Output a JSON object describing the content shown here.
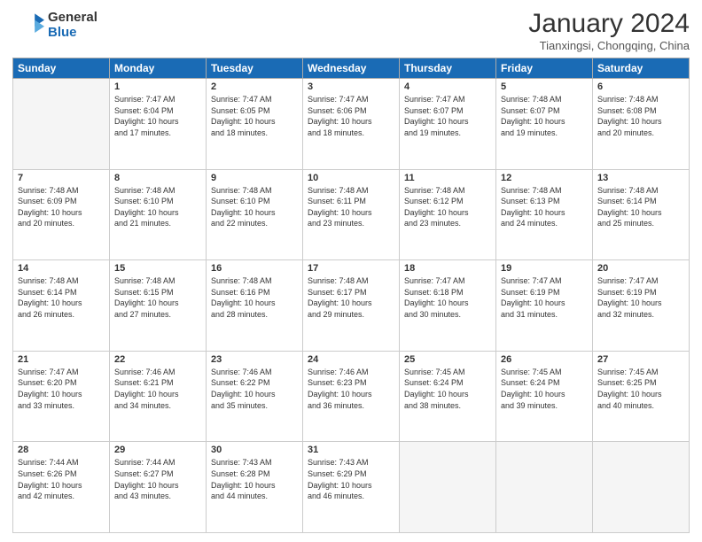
{
  "logo": {
    "line1": "General",
    "line2": "Blue"
  },
  "title": "January 2024",
  "subtitle": "Tianxingsi, Chongqing, China",
  "headers": [
    "Sunday",
    "Monday",
    "Tuesday",
    "Wednesday",
    "Thursday",
    "Friday",
    "Saturday"
  ],
  "weeks": [
    [
      {
        "num": "",
        "info": ""
      },
      {
        "num": "1",
        "info": "Sunrise: 7:47 AM\nSunset: 6:04 PM\nDaylight: 10 hours\nand 17 minutes."
      },
      {
        "num": "2",
        "info": "Sunrise: 7:47 AM\nSunset: 6:05 PM\nDaylight: 10 hours\nand 18 minutes."
      },
      {
        "num": "3",
        "info": "Sunrise: 7:47 AM\nSunset: 6:06 PM\nDaylight: 10 hours\nand 18 minutes."
      },
      {
        "num": "4",
        "info": "Sunrise: 7:47 AM\nSunset: 6:07 PM\nDaylight: 10 hours\nand 19 minutes."
      },
      {
        "num": "5",
        "info": "Sunrise: 7:48 AM\nSunset: 6:07 PM\nDaylight: 10 hours\nand 19 minutes."
      },
      {
        "num": "6",
        "info": "Sunrise: 7:48 AM\nSunset: 6:08 PM\nDaylight: 10 hours\nand 20 minutes."
      }
    ],
    [
      {
        "num": "7",
        "info": "Sunrise: 7:48 AM\nSunset: 6:09 PM\nDaylight: 10 hours\nand 20 minutes."
      },
      {
        "num": "8",
        "info": "Sunrise: 7:48 AM\nSunset: 6:10 PM\nDaylight: 10 hours\nand 21 minutes."
      },
      {
        "num": "9",
        "info": "Sunrise: 7:48 AM\nSunset: 6:10 PM\nDaylight: 10 hours\nand 22 minutes."
      },
      {
        "num": "10",
        "info": "Sunrise: 7:48 AM\nSunset: 6:11 PM\nDaylight: 10 hours\nand 23 minutes."
      },
      {
        "num": "11",
        "info": "Sunrise: 7:48 AM\nSunset: 6:12 PM\nDaylight: 10 hours\nand 23 minutes."
      },
      {
        "num": "12",
        "info": "Sunrise: 7:48 AM\nSunset: 6:13 PM\nDaylight: 10 hours\nand 24 minutes."
      },
      {
        "num": "13",
        "info": "Sunrise: 7:48 AM\nSunset: 6:14 PM\nDaylight: 10 hours\nand 25 minutes."
      }
    ],
    [
      {
        "num": "14",
        "info": "Sunrise: 7:48 AM\nSunset: 6:14 PM\nDaylight: 10 hours\nand 26 minutes."
      },
      {
        "num": "15",
        "info": "Sunrise: 7:48 AM\nSunset: 6:15 PM\nDaylight: 10 hours\nand 27 minutes."
      },
      {
        "num": "16",
        "info": "Sunrise: 7:48 AM\nSunset: 6:16 PM\nDaylight: 10 hours\nand 28 minutes."
      },
      {
        "num": "17",
        "info": "Sunrise: 7:48 AM\nSunset: 6:17 PM\nDaylight: 10 hours\nand 29 minutes."
      },
      {
        "num": "18",
        "info": "Sunrise: 7:47 AM\nSunset: 6:18 PM\nDaylight: 10 hours\nand 30 minutes."
      },
      {
        "num": "19",
        "info": "Sunrise: 7:47 AM\nSunset: 6:19 PM\nDaylight: 10 hours\nand 31 minutes."
      },
      {
        "num": "20",
        "info": "Sunrise: 7:47 AM\nSunset: 6:19 PM\nDaylight: 10 hours\nand 32 minutes."
      }
    ],
    [
      {
        "num": "21",
        "info": "Sunrise: 7:47 AM\nSunset: 6:20 PM\nDaylight: 10 hours\nand 33 minutes."
      },
      {
        "num": "22",
        "info": "Sunrise: 7:46 AM\nSunset: 6:21 PM\nDaylight: 10 hours\nand 34 minutes."
      },
      {
        "num": "23",
        "info": "Sunrise: 7:46 AM\nSunset: 6:22 PM\nDaylight: 10 hours\nand 35 minutes."
      },
      {
        "num": "24",
        "info": "Sunrise: 7:46 AM\nSunset: 6:23 PM\nDaylight: 10 hours\nand 36 minutes."
      },
      {
        "num": "25",
        "info": "Sunrise: 7:45 AM\nSunset: 6:24 PM\nDaylight: 10 hours\nand 38 minutes."
      },
      {
        "num": "26",
        "info": "Sunrise: 7:45 AM\nSunset: 6:24 PM\nDaylight: 10 hours\nand 39 minutes."
      },
      {
        "num": "27",
        "info": "Sunrise: 7:45 AM\nSunset: 6:25 PM\nDaylight: 10 hours\nand 40 minutes."
      }
    ],
    [
      {
        "num": "28",
        "info": "Sunrise: 7:44 AM\nSunset: 6:26 PM\nDaylight: 10 hours\nand 42 minutes."
      },
      {
        "num": "29",
        "info": "Sunrise: 7:44 AM\nSunset: 6:27 PM\nDaylight: 10 hours\nand 43 minutes."
      },
      {
        "num": "30",
        "info": "Sunrise: 7:43 AM\nSunset: 6:28 PM\nDaylight: 10 hours\nand 44 minutes."
      },
      {
        "num": "31",
        "info": "Sunrise: 7:43 AM\nSunset: 6:29 PM\nDaylight: 10 hours\nand 46 minutes."
      },
      {
        "num": "",
        "info": ""
      },
      {
        "num": "",
        "info": ""
      },
      {
        "num": "",
        "info": ""
      }
    ]
  ]
}
